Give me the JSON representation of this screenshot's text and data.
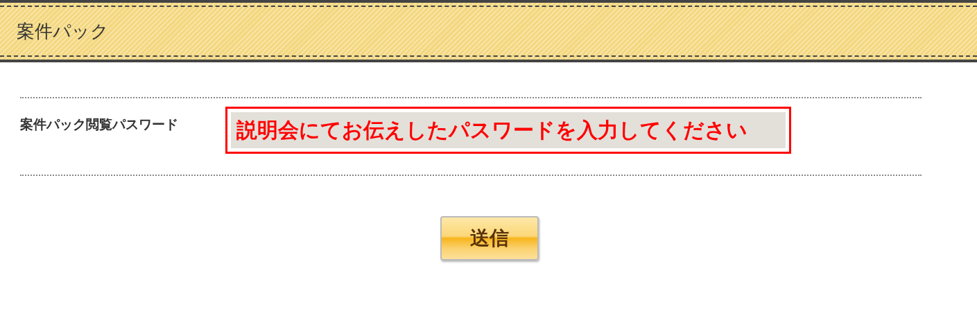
{
  "header": {
    "title": "案件パック"
  },
  "form": {
    "rows": [
      {
        "label": "案件パック閲覧パスワード",
        "field": {
          "value": "説明会にてお伝えしたパスワードを入力してください",
          "highlighted": true
        }
      }
    ]
  },
  "submit_button": {
    "label": "送信"
  }
}
